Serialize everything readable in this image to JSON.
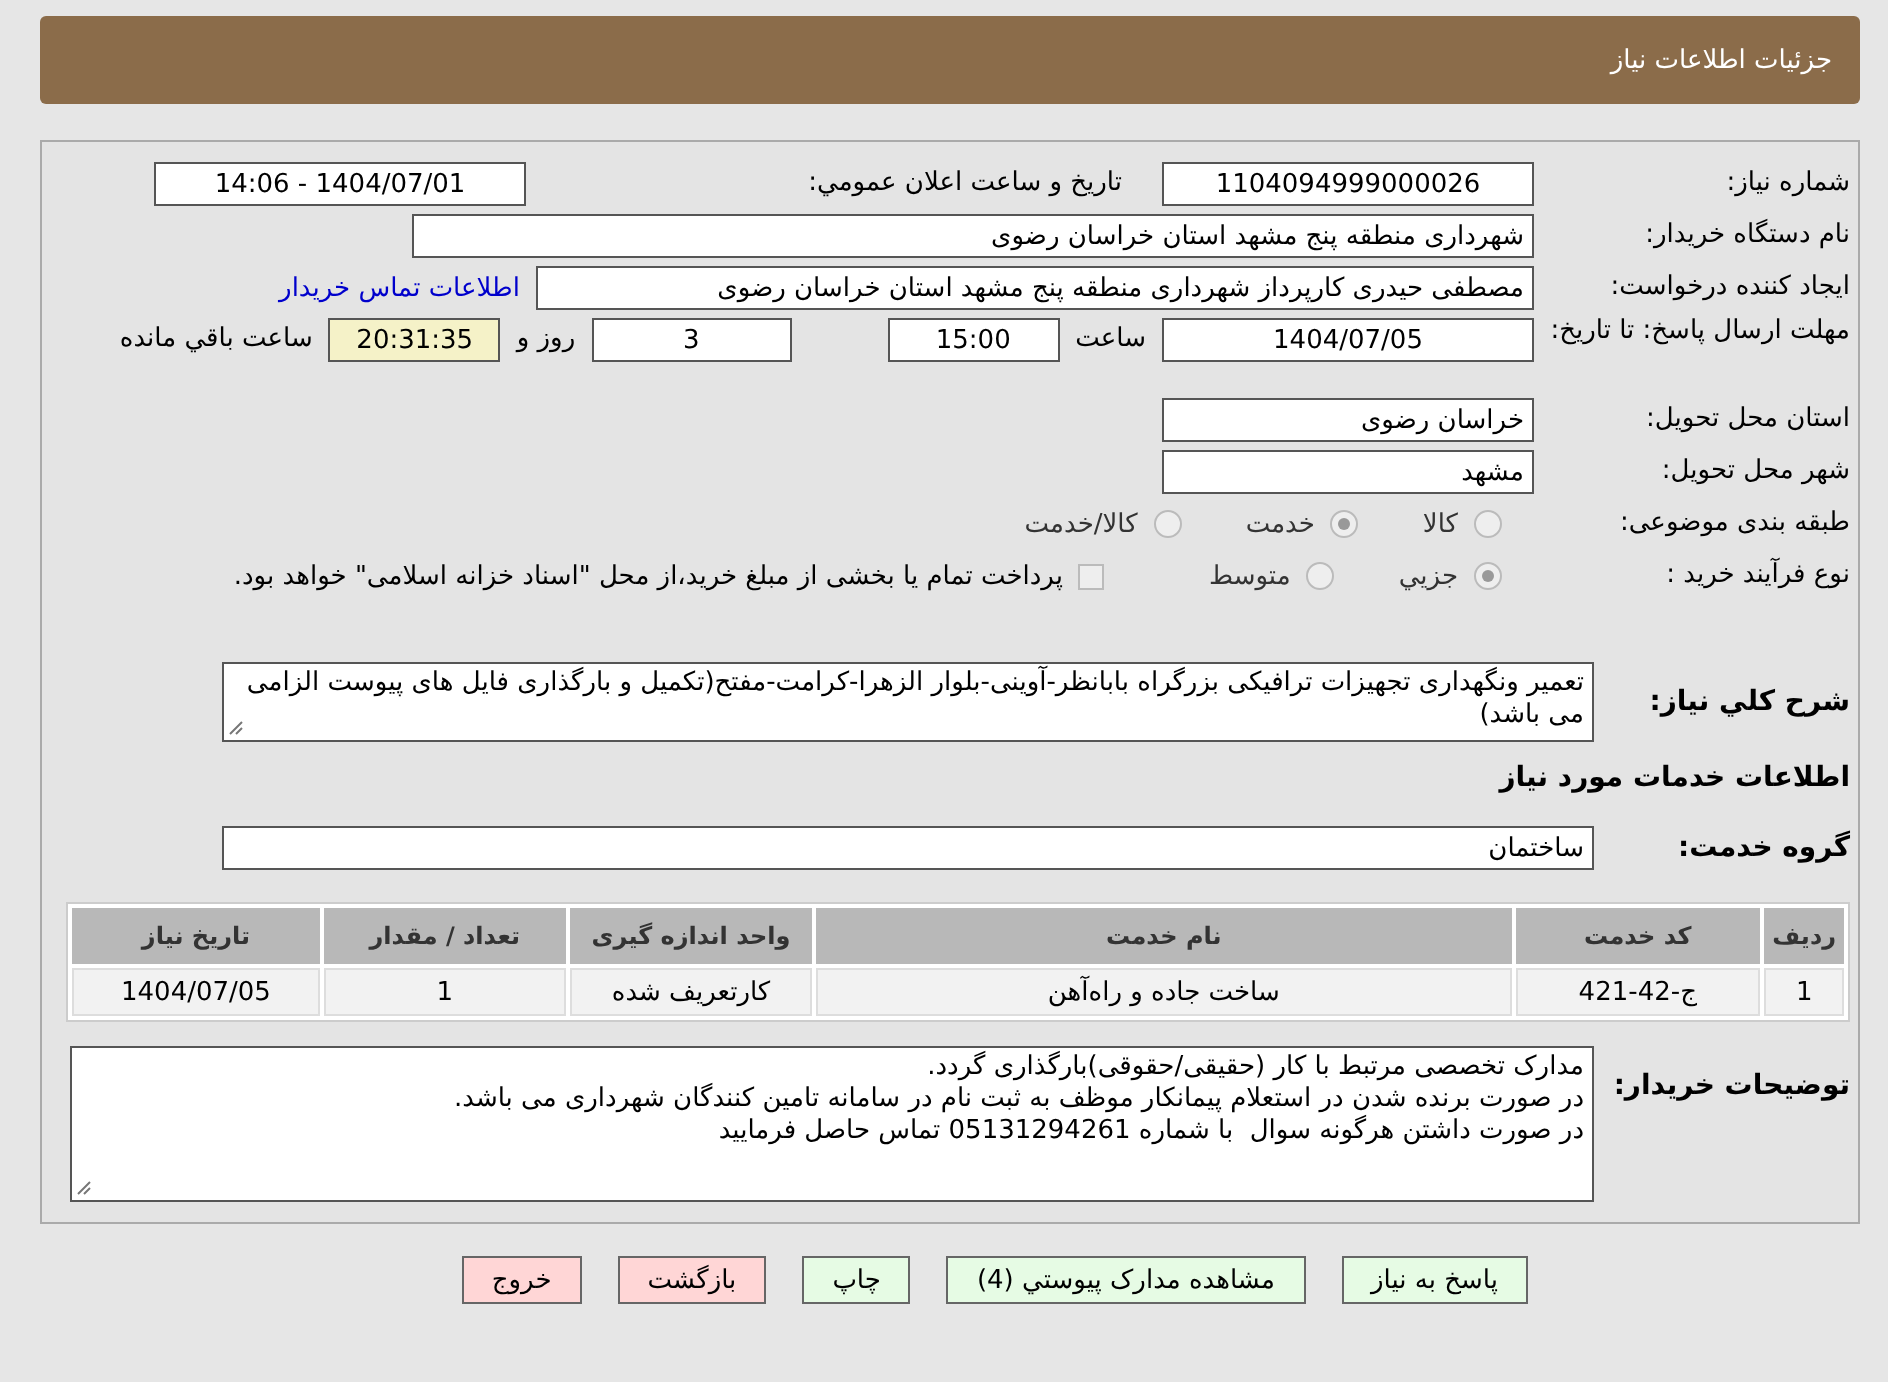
{
  "header": {
    "title": "جزئیات اطلاعات نیاز"
  },
  "fields": {
    "need_number": {
      "label": "شماره نیاز:",
      "value": "1104094999000026"
    },
    "announce": {
      "label": "تاريخ و ساعت اعلان عمومي:",
      "value": "1404/07/01 - 14:06"
    },
    "buyer": {
      "label": "نام دستگاه خريدار:",
      "value": "شهرداری منطقه پنج مشهد استان خراسان رضوی"
    },
    "creator": {
      "label": "ايجاد کننده درخواست:",
      "value": "مصطفی حیدری کارپرداز شهرداری منطقه پنج مشهد استان خراسان رضوی",
      "link": "اطلاعات تماس خريدار"
    },
    "deadline": {
      "label": "مهلت ارسال پاسخ: تا تاریخ:",
      "date": "1404/07/05",
      "time_label": "ساعت",
      "time": "15:00",
      "days": "3",
      "days_label": "روز و",
      "remaining": "20:31:35",
      "remaining_label": "ساعت باقي مانده"
    },
    "province": {
      "label": "استان محل تحویل:",
      "value": "خراسان رضوی"
    },
    "city": {
      "label": "شهر محل تحویل:",
      "value": "مشهد"
    }
  },
  "category": {
    "label": "طبقه بندی موضوعی:",
    "options": [
      {
        "label": "کالا",
        "selected": false
      },
      {
        "label": "خدمت",
        "selected": true
      },
      {
        "label": "کالا/خدمت",
        "selected": false
      }
    ]
  },
  "process": {
    "label": "نوع فرآیند خرید :",
    "options": [
      {
        "label": "جزيي",
        "selected": true
      },
      {
        "label": "متوسط",
        "selected": false
      }
    ],
    "payment": {
      "label": "پرداخت تمام یا بخشی از مبلغ خرید،از محل \"اسناد خزانه اسلامی\" خواهد بود.",
      "checked": false
    }
  },
  "description": {
    "label": "شرح كلي نياز:",
    "value": "تعمیر ونگهداری تجهیزات ترافیکی بزرگراه بابانظر-آوینی-بلوار الزهرا-کرامت-مفتح(تکمیل و بارگذاری فایل های پیوست الزامی می باشد)"
  },
  "services_title": "اطلاعات خدمات مورد نياز",
  "service_group": {
    "label": "گروه خدمت:",
    "value": "ساختمان"
  },
  "table": {
    "columns": [
      "ردیف",
      "کد خدمت",
      "نام خدمت",
      "واحد اندازه گیری",
      "تعداد / مقدار",
      "تاریخ نیاز"
    ],
    "rows": [
      [
        "1",
        "ج-42-421",
        "ساخت جاده و راه‌آهن",
        "کارتعریف شده",
        "1",
        "1404/07/05"
      ]
    ]
  },
  "notes": {
    "label": "توضیحات خریدار:",
    "lines": [
      "مدارک تخصصی مرتبط با کار (حقیقی/حقوقی)بارگذاری گردد.",
      "در صورت برنده شدن در استعلام پیمانکار موظف به ثبت نام در سامانه تامین کنندگان شهرداری می باشد.",
      "در صورت داشتن هرگونه سوال  با شماره 05131294261 تماس حاصل فرمایید"
    ]
  },
  "buttons": [
    {
      "label": "پاسخ به نياز",
      "kind": "action"
    },
    {
      "label": "مشاهده مدارک پيوستي (4)",
      "kind": "action"
    },
    {
      "label": "چاپ",
      "kind": "action"
    },
    {
      "label": "بازگشت",
      "kind": "exit"
    },
    {
      "label": "خروج",
      "kind": "exit"
    }
  ]
}
